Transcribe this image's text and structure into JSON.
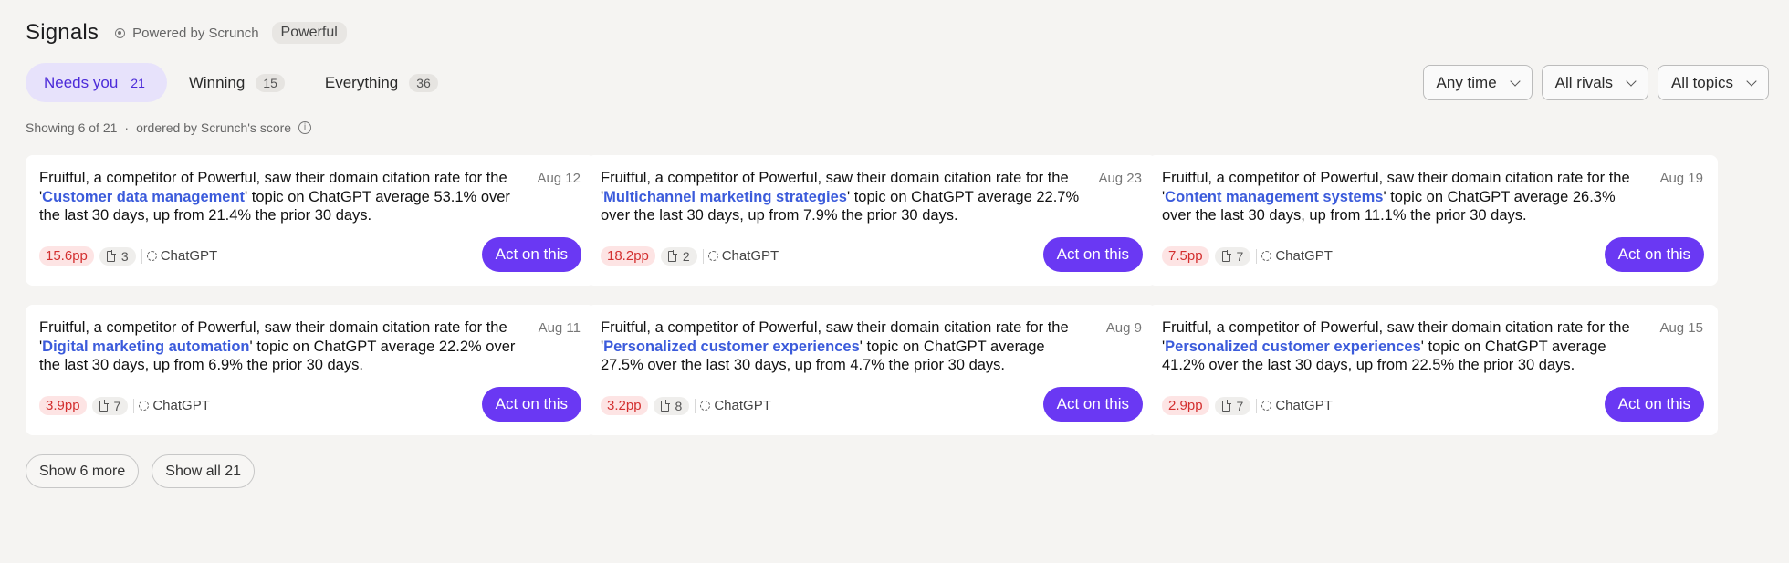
{
  "header": {
    "title": "Signals",
    "powered_by": "Powered by Scrunch",
    "brand": "Powerful"
  },
  "tabs": [
    {
      "label": "Needs you",
      "count": "21",
      "active": true
    },
    {
      "label": "Winning",
      "count": "15",
      "active": false
    },
    {
      "label": "Everything",
      "count": "36",
      "active": false
    }
  ],
  "filters": {
    "time": "Any time",
    "rivals": "All rivals",
    "topics": "All topics"
  },
  "showing": {
    "count_text": "Showing 6 of 21",
    "order_text": "ordered by Scrunch's score",
    "separator": "·",
    "info_icon": "i"
  },
  "text": {
    "prefix": "Fruitful, a competitor of Powerful, saw their domain citation rate for the '",
    "mid1": "' topic on ChatGPT average ",
    "mid2": " over the last 30 days, up from ",
    "suffix": " the prior 30 days."
  },
  "cards": [
    {
      "topic": "Customer data management",
      "current": "53.1%",
      "prior": "21.4%",
      "date": "Aug 12",
      "delta": "15.6pp",
      "docs": "3",
      "source": "ChatGPT",
      "action": "Act on this"
    },
    {
      "topic": "Multichannel marketing strategies",
      "current": "22.7%",
      "prior": "7.9%",
      "date": "Aug 23",
      "delta": "18.2pp",
      "docs": "2",
      "source": "ChatGPT",
      "action": "Act on this"
    },
    {
      "topic": "Content management systems",
      "current": "26.3%",
      "prior": "11.1%",
      "date": "Aug 19",
      "delta": "7.5pp",
      "docs": "7",
      "source": "ChatGPT",
      "action": "Act on this"
    },
    {
      "topic": "Digital marketing automation",
      "current": "22.2%",
      "prior": "6.9%",
      "date": "Aug 11",
      "delta": "3.9pp",
      "docs": "7",
      "source": "ChatGPT",
      "action": "Act on this"
    },
    {
      "topic": "Personalized customer experiences",
      "current": "27.5%",
      "prior": "4.7%",
      "date": "Aug 9",
      "delta": "3.2pp",
      "docs": "8",
      "source": "ChatGPT",
      "action": "Act on this"
    },
    {
      "topic": "Personalized customer experiences",
      "current": "41.2%",
      "prior": "22.5%",
      "date": "Aug 15",
      "delta": "2.9pp",
      "docs": "7",
      "source": "ChatGPT",
      "action": "Act on this"
    }
  ],
  "bottom": {
    "show_more": "Show 6 more",
    "show_all": "Show all 21"
  },
  "colors": {
    "accent": "#6a38f3",
    "active_tab_bg": "#e7e2fb",
    "topic_link": "#3b5bdb",
    "delta_red": "#d32f2f",
    "background": "#f5f4f2"
  }
}
